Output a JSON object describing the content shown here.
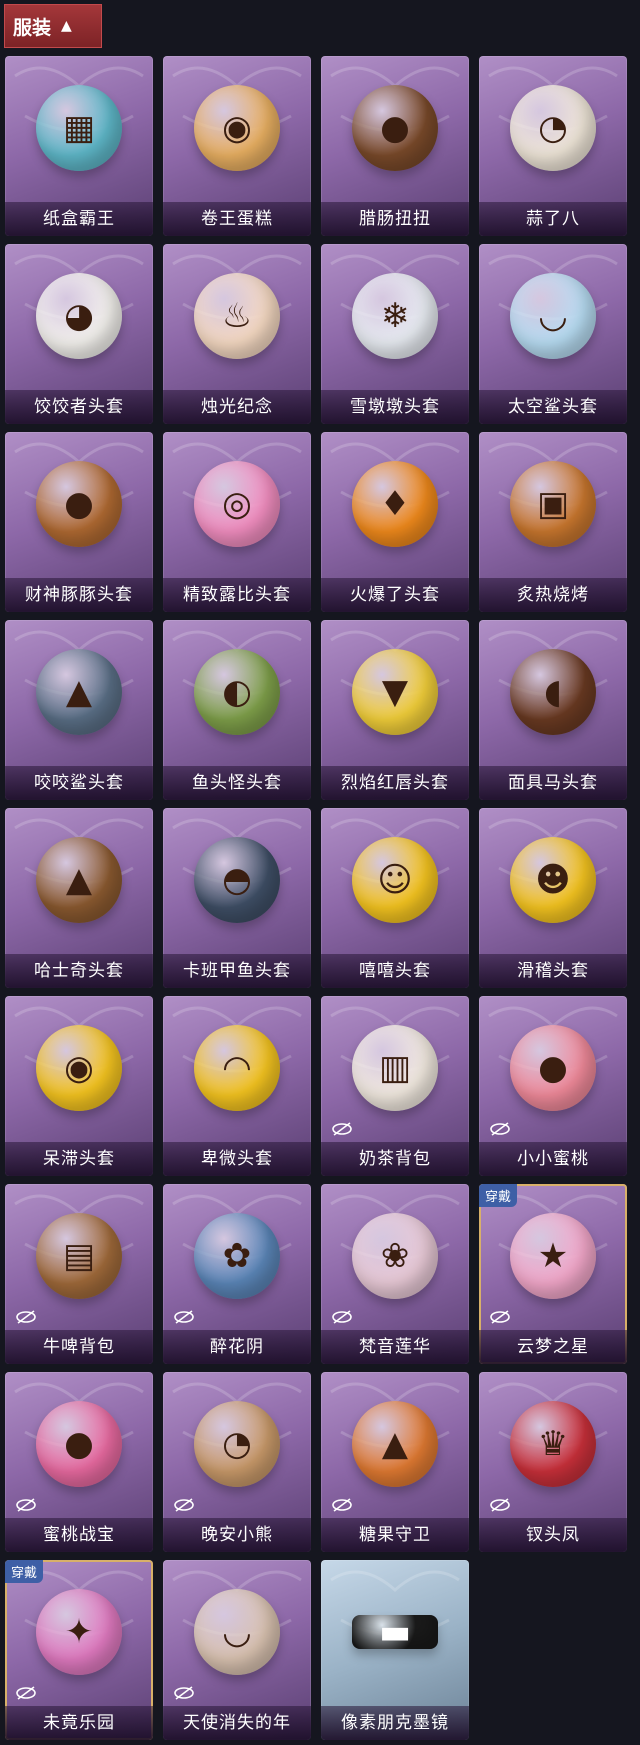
{
  "header": {
    "title": "服装"
  },
  "items": [
    {
      "name": "纸盒霸王",
      "color": "#5fb8c9",
      "glyph": "▦",
      "eye": false,
      "worn": false
    },
    {
      "name": "卷王蛋糕",
      "color": "#e9b062",
      "glyph": "◉",
      "eye": false,
      "worn": false
    },
    {
      "name": "腊肠扭扭",
      "color": "#7a4a2a",
      "glyph": "●",
      "eye": false,
      "worn": false
    },
    {
      "name": "蒜了八",
      "color": "#efe6d8",
      "glyph": "◔",
      "eye": false,
      "worn": false
    },
    {
      "name": "饺饺者头套",
      "color": "#f4f2ee",
      "glyph": "◕",
      "eye": false,
      "worn": false
    },
    {
      "name": "烛光纪念",
      "color": "#f5d9c2",
      "glyph": "♨",
      "eye": false,
      "worn": false
    },
    {
      "name": "雪墩墩头套",
      "color": "#e8ecf2",
      "glyph": "❄",
      "eye": false,
      "worn": false
    },
    {
      "name": "太空鲨头套",
      "color": "#b7dcf2",
      "glyph": "◡",
      "eye": false,
      "worn": false
    },
    {
      "name": "财神豚豚头套",
      "color": "#b06a32",
      "glyph": "●",
      "eye": false,
      "worn": false
    },
    {
      "name": "精致露比头套",
      "color": "#f28ec0",
      "glyph": "◎",
      "eye": false,
      "worn": false
    },
    {
      "name": "火爆了头套",
      "color": "#f08a1c",
      "glyph": "♦",
      "eye": false,
      "worn": false
    },
    {
      "name": "炙热烧烤",
      "color": "#c9772e",
      "glyph": "▣",
      "eye": false,
      "worn": false
    },
    {
      "name": "咬咬鲨头套",
      "color": "#5a6f86",
      "glyph": "▲",
      "eye": false,
      "worn": false
    },
    {
      "name": "鱼头怪头套",
      "color": "#7fa04a",
      "glyph": "◐",
      "eye": false,
      "worn": false
    },
    {
      "name": "烈焰红唇头套",
      "color": "#f2cf3a",
      "glyph": "▼",
      "eye": false,
      "worn": false
    },
    {
      "name": "面具马头套",
      "color": "#6a3a22",
      "glyph": "◖",
      "eye": false,
      "worn": false
    },
    {
      "name": "哈士奇头套",
      "color": "#8b5a30",
      "glyph": "▲",
      "eye": false,
      "worn": false
    },
    {
      "name": "卡班甲鱼头套",
      "color": "#3f4f66",
      "glyph": "◓",
      "eye": false,
      "worn": false
    },
    {
      "name": "嘻嘻头套",
      "color": "#f5c520",
      "glyph": "☺",
      "eye": false,
      "worn": false
    },
    {
      "name": "滑稽头套",
      "color": "#f5c520",
      "glyph": "☻",
      "eye": false,
      "worn": false
    },
    {
      "name": "呆滞头套",
      "color": "#f5c520",
      "glyph": "◉",
      "eye": false,
      "worn": false
    },
    {
      "name": "卑微头套",
      "color": "#f5c520",
      "glyph": "◠",
      "eye": false,
      "worn": false
    },
    {
      "name": "奶茶背包",
      "color": "#f2eae0",
      "glyph": "▥",
      "eye": true,
      "worn": false
    },
    {
      "name": "小小蜜桃",
      "color": "#f08a9a",
      "glyph": "●",
      "eye": true,
      "worn": false
    },
    {
      "name": "牛啤背包",
      "color": "#a06a3a",
      "glyph": "▤",
      "eye": true,
      "worn": false
    },
    {
      "name": "醉花阴",
      "color": "#5b86b8",
      "glyph": "✿",
      "eye": true,
      "worn": false
    },
    {
      "name": "梵音莲华",
      "color": "#e8c9d6",
      "glyph": "❀",
      "eye": true,
      "worn": false
    },
    {
      "name": "云梦之星",
      "color": "#f2a7c9",
      "glyph": "★",
      "eye": true,
      "worn": true
    },
    {
      "name": "蜜桃战宝",
      "color": "#e86aa0",
      "glyph": "●",
      "eye": true,
      "worn": false
    },
    {
      "name": "晚安小熊",
      "color": "#c99a6a",
      "glyph": "◔",
      "eye": true,
      "worn": false
    },
    {
      "name": "糖果守卫",
      "color": "#e07a32",
      "glyph": "▲",
      "eye": true,
      "worn": false
    },
    {
      "name": "钗头凤",
      "color": "#c9303a",
      "glyph": "♛",
      "eye": true,
      "worn": false
    },
    {
      "name": "未竟乐园",
      "color": "#e07ac0",
      "glyph": "✦",
      "eye": true,
      "worn": true
    },
    {
      "name": "天使消失的年",
      "color": "#d9c2b0",
      "glyph": "◡",
      "eye": true,
      "worn": false
    },
    {
      "name": "像素朋克墨镜",
      "color": "#1a1a1a",
      "glyph": "▬",
      "eye": false,
      "worn": false,
      "blue": true
    }
  ],
  "worn_badge": "穿戴",
  "icons": {
    "header": "chevron-up-icon",
    "hidden": "eye-slash-icon"
  }
}
